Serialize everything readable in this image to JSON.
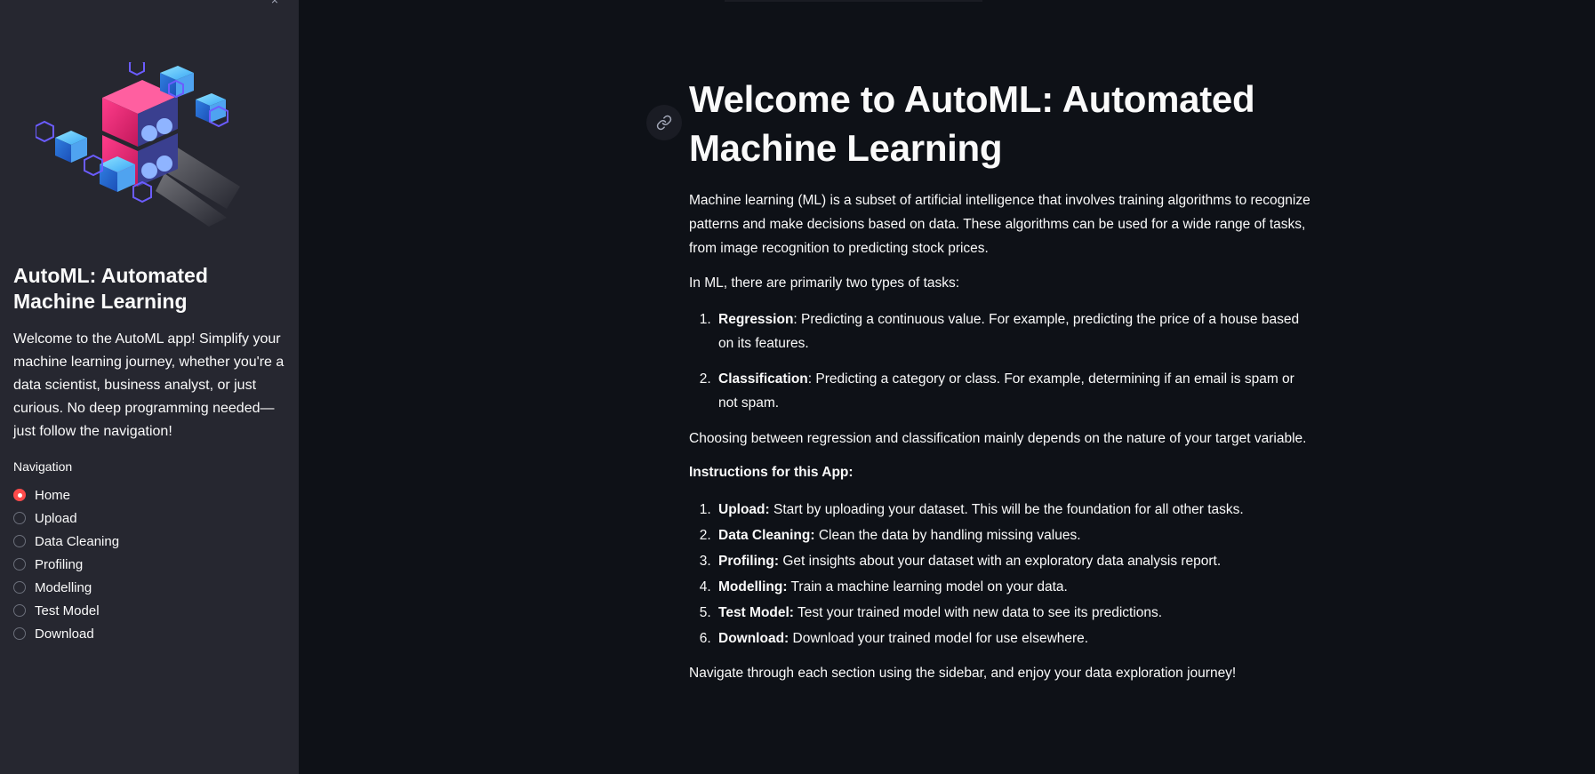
{
  "sidebar": {
    "collapse_icon": "×",
    "title": "AutoML: Automated Machine Learning",
    "description": "Welcome to the AutoML app! Simplify your machine learning journey, whether you're a data scientist, business analyst, or just curious. No deep programming needed—just follow the navigation!",
    "nav_label": "Navigation",
    "nav_items": [
      {
        "label": "Home",
        "selected": true
      },
      {
        "label": "Upload",
        "selected": false
      },
      {
        "label": "Data Cleaning",
        "selected": false
      },
      {
        "label": "Profiling",
        "selected": false
      },
      {
        "label": "Modelling",
        "selected": false
      },
      {
        "label": "Test Model",
        "selected": false
      },
      {
        "label": "Download",
        "selected": false
      }
    ]
  },
  "main": {
    "title": "Welcome to AutoML: Automated Machine Learning",
    "intro": "Machine learning (ML) is a subset of artificial intelligence that involves training algorithms to recognize patterns and make decisions based on data. These algorithms can be used for a wide range of tasks, from image recognition to predicting stock prices.",
    "tasks_intro": "In ML, there are primarily two types of tasks:",
    "tasks": [
      {
        "term": "Regression",
        "text": ": Predicting a continuous value. For example, predicting the price of a house based on its features."
      },
      {
        "term": "Classification",
        "text": ": Predicting a category or class. For example, determining if an email is spam or not spam."
      }
    ],
    "choosing": "Choosing between regression and classification mainly depends on the nature of your target variable.",
    "instructions_heading": "Instructions for this App:",
    "instructions": [
      {
        "term": "Upload:",
        "text": " Start by uploading your dataset. This will be the foundation for all other tasks."
      },
      {
        "term": "Data Cleaning:",
        "text": " Clean the data by handling missing values."
      },
      {
        "term": "Profiling:",
        "text": " Get insights about your dataset with an exploratory data analysis report."
      },
      {
        "term": "Modelling:",
        "text": " Train a machine learning model on your data."
      },
      {
        "term": "Test Model:",
        "text": " Test your trained model with new data to see its predictions."
      },
      {
        "term": "Download:",
        "text": " Download your trained model for use elsewhere."
      }
    ],
    "closing": "Navigate through each section using the sidebar, and enjoy your data exploration journey!"
  },
  "colors": {
    "background": "#0e1117",
    "sidebar": "#262730",
    "accent": "#ff4b4b",
    "text": "#fafafa"
  }
}
